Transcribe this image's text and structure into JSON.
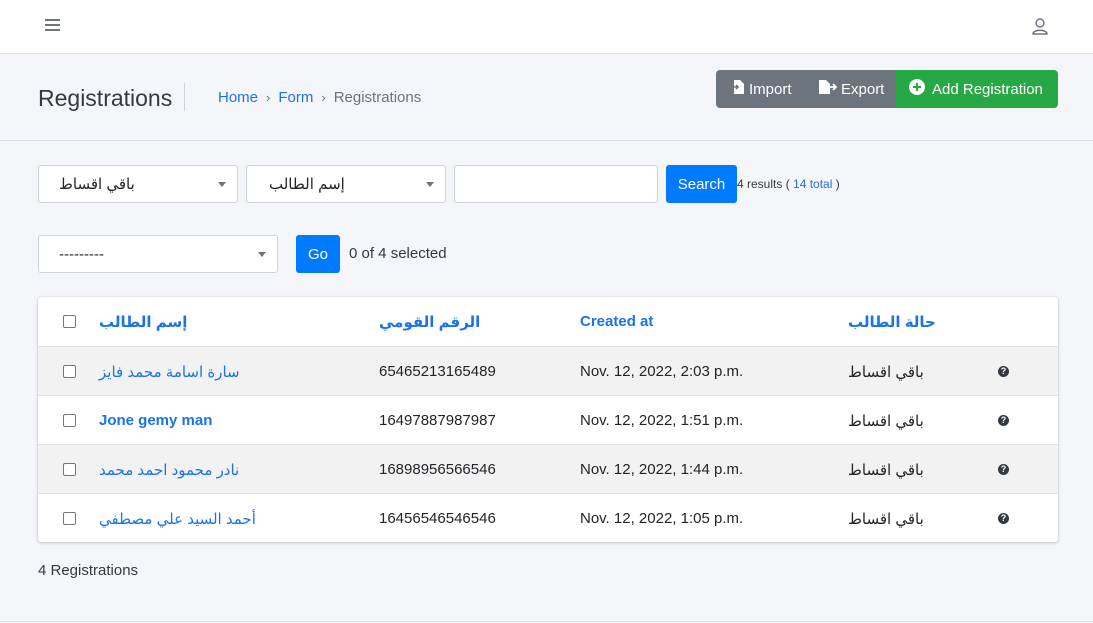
{
  "topbar": {
    "menu_icon": "hamburger-icon",
    "user_icon": "user-icon"
  },
  "header": {
    "title": "Registrations",
    "breadcrumb": [
      "Home",
      "Form",
      "Registrations"
    ],
    "buttons": {
      "import": "Import",
      "export": "Export",
      "add": "Add Registration"
    }
  },
  "filters": {
    "status_filter": "باقي اقساط",
    "search_field": "إسم الطالب",
    "search_value": "",
    "search_button": "Search",
    "results_prefix": "4 results ( ",
    "results_total": "14 total",
    "results_suffix": " )"
  },
  "actions": {
    "action_select": "---------",
    "go_button": "Go",
    "selected_text": "0 of 4 selected"
  },
  "table": {
    "headers": [
      "إسم الطالب",
      "الرقم القومي",
      "Created at",
      "حالة الطالب"
    ],
    "rows": [
      {
        "name": "سارة اسامة محمد فايز",
        "national_id": "65465213165489",
        "created_at": "Nov. 12, 2022, 2:03 p.m.",
        "status": "باقي اقساط"
      },
      {
        "name": "Jone gemy man",
        "national_id": "16497887987987",
        "created_at": "Nov. 12, 2022, 1:51 p.m.",
        "status": "باقي اقساط"
      },
      {
        "name": "نادر محمود احمد محمد",
        "national_id": "16898956566546",
        "created_at": "Nov. 12, 2022, 1:44 p.m.",
        "status": "باقي اقساط"
      },
      {
        "name": "أحمد السيد علي مصطفي",
        "national_id": "16456546546546",
        "created_at": "Nov. 12, 2022, 1:05 p.m.",
        "status": "باقي اقساط"
      }
    ]
  },
  "footer": {
    "count": "4 Registrations"
  },
  "colors": {
    "primary": "#007bff",
    "success": "#28a745",
    "secondary": "#6c757d",
    "link": "#1a73e8"
  }
}
